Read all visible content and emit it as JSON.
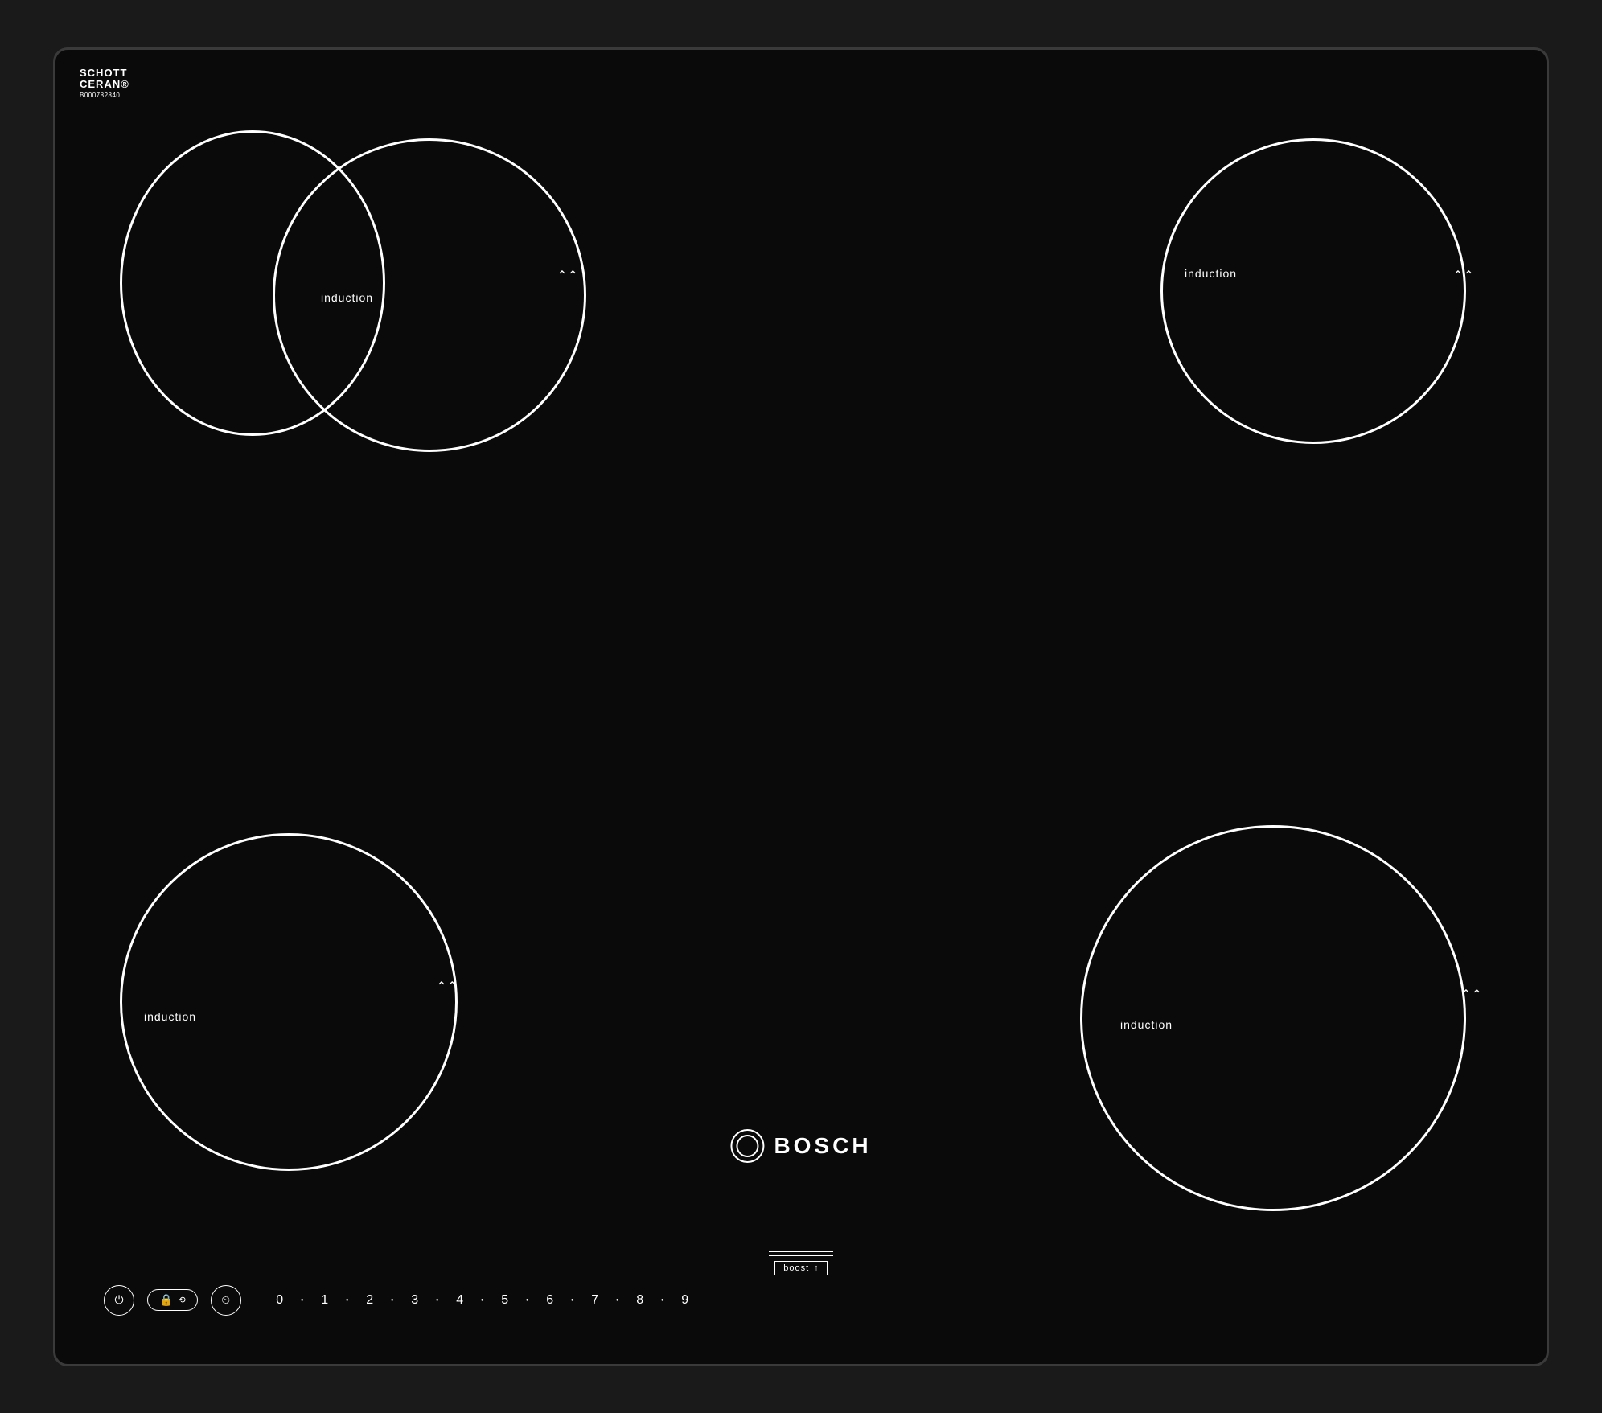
{
  "brand": {
    "schott_line1": "SCHOTT",
    "schott_line2": "CERAN®",
    "model": "B000782840"
  },
  "bosch_logo": "BOSCH",
  "zones": {
    "top_left": {
      "label": "induction"
    },
    "top_right": {
      "label": "induction"
    },
    "bottom_left": {
      "label": "induction"
    },
    "bottom_right": {
      "label": "induction"
    }
  },
  "boost": {
    "label": "boost",
    "arrow": "↑"
  },
  "controls": {
    "power_label": "⏻",
    "lock_label": "🔒",
    "timer_label": "⏲",
    "scale": [
      "0",
      "1",
      "2",
      "3",
      "4",
      "5",
      "6",
      "7",
      "8",
      "9"
    ]
  }
}
